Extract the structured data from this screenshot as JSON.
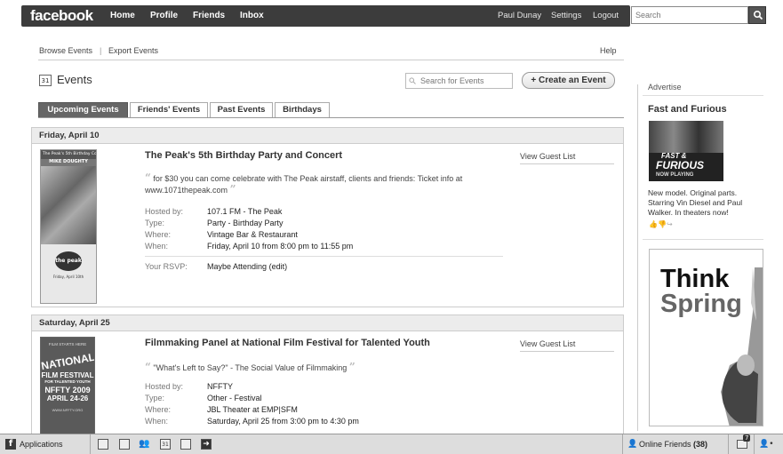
{
  "topbar": {
    "logo": "facebook",
    "nav": [
      "Home",
      "Profile",
      "Friends",
      "Inbox"
    ],
    "user": "Paul Dunay",
    "settings": "Settings",
    "logout": "Logout",
    "search_placeholder": "Search"
  },
  "subnav": {
    "browse": "Browse Events",
    "separator": "|",
    "export": "Export Events",
    "help": "Help"
  },
  "events_page": {
    "title": "Events",
    "calendar_icon_text": "31",
    "search_placeholder": "Search for Events",
    "create_button": "+ Create an Event"
  },
  "tabs": [
    {
      "label": "Upcoming Events",
      "active": true
    },
    {
      "label": "Friends' Events",
      "active": false
    },
    {
      "label": "Past Events",
      "active": false
    },
    {
      "label": "Birthdays",
      "active": false
    }
  ],
  "days": [
    {
      "date": "Friday, April 10",
      "event": {
        "title": "The Peak's 5th Birthday Party and Concert",
        "guest_list": "View Guest List",
        "description": "for $30 you can come celebrate with The Peak airstaff, clients and friends: Ticket info at www.1071thepeak.com",
        "labels": {
          "host": "Hosted by:",
          "type": "Type:",
          "where": "Where:",
          "when": "When:",
          "rsvp": "Your RSVP:"
        },
        "host": "107.1 FM - The Peak",
        "type": "Party - Birthday Party",
        "where": "Vintage Bar & Restaurant",
        "when": "Friday, April 10 from 8:00 pm to 11:55 pm",
        "rsvp": "Maybe Attending",
        "rsvp_edit": "(edit)",
        "poster_lines": [
          "The Peak's 5th Birthday Concert!",
          "MIKE DOUGHTY",
          "the peak",
          "Friday, April 10th"
        ]
      }
    },
    {
      "date": "Saturday, April 25",
      "event": {
        "title": "Filmmaking Panel at National Film Festival for Talented Youth",
        "guest_list": "View Guest List",
        "description": "\"What's Left to Say?\" - The Social Value of Filmmaking",
        "labels": {
          "host": "Hosted by:",
          "type": "Type:",
          "where": "Where:",
          "when": "When:"
        },
        "host": "NFFTY",
        "type": "Other - Festival",
        "where": "JBL Theater at EMP|SFM",
        "when": "Saturday, April 25 from 3:00 pm to 4:30 pm",
        "poster_lines": [
          "FILM STARTS HERE",
          "NATIONAL",
          "FILM FESTIVAL",
          "FOR TALENTED YOUTH",
          "NFFTY 2009",
          "APRIL 24-26",
          "WWW.NFFTY.ORG"
        ]
      }
    }
  ],
  "sidebar": {
    "advertise": "Advertise",
    "ad_title": "Fast and Furious",
    "ad_image_lines": [
      "FAST &",
      "FURIOUS",
      "NOW PLAYING"
    ],
    "ad_text": "New model. Original parts. Starring Vin Diesel and Paul Walker. In theaters now!",
    "ad2_line1": "Think",
    "ad2_line2": "Spring"
  },
  "bottombar": {
    "applications": "Applications",
    "online_label": "Online Friends",
    "online_count": "(38)",
    "notifications": "7"
  }
}
